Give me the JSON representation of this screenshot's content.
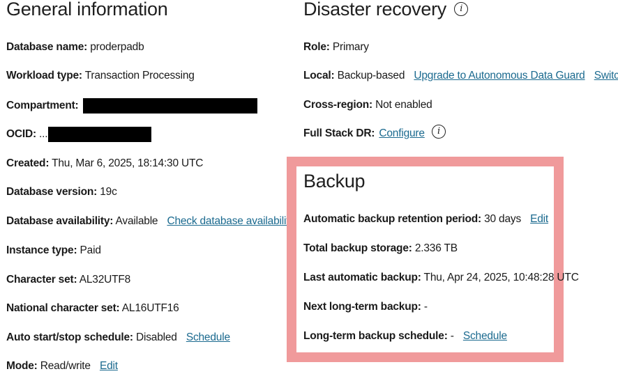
{
  "general": {
    "title": "General information",
    "database_name": {
      "label": "Database name:",
      "value": "proderpadb"
    },
    "workload_type": {
      "label": "Workload type:",
      "value": "Transaction Processing"
    },
    "compartment": {
      "label": "Compartment:"
    },
    "ocid": {
      "label": "OCID:",
      "value": "..."
    },
    "created": {
      "label": "Created:",
      "value": "Thu, Mar 6, 2025, 18:14:30 UTC"
    },
    "database_version": {
      "label": "Database version:",
      "value": "19c"
    },
    "database_availability": {
      "label": "Database availability:",
      "value": "Available",
      "link": "Check database availability"
    },
    "instance_type": {
      "label": "Instance type:",
      "value": "Paid"
    },
    "character_set": {
      "label": "Character set:",
      "value": "AL32UTF8"
    },
    "national_character_set": {
      "label": "National character set:",
      "value": "AL16UTF16"
    },
    "auto_start_stop": {
      "label": "Auto start/stop schedule:",
      "value": "Disabled",
      "link": "Schedule"
    },
    "mode": {
      "label": "Mode:",
      "value": "Read/write",
      "link": "Edit"
    }
  },
  "disaster_recovery": {
    "title": "Disaster recovery",
    "role": {
      "label": "Role:",
      "value": "Primary"
    },
    "local": {
      "label": "Local:",
      "value": "Backup-based",
      "link1": "Upgrade to Autonomous Data Guard",
      "link2": "Switchover"
    },
    "cross_region": {
      "label": "Cross-region:",
      "value": "Not enabled"
    },
    "full_stack_dr": {
      "label": "Full Stack DR:",
      "link": "Configure"
    }
  },
  "backup": {
    "title": "Backup",
    "retention": {
      "label": "Automatic backup retention period:",
      "value": "30 days",
      "link": "Edit"
    },
    "total_storage": {
      "label": "Total backup storage:",
      "value": "2.336 TB"
    },
    "last_automatic": {
      "label": "Last automatic backup:",
      "value": "Thu, Apr 24, 2025, 10:48:28 UTC"
    },
    "next_long_term": {
      "label": "Next long-term backup:",
      "value": "-"
    },
    "long_term_schedule": {
      "label": "Long-term backup schedule:",
      "value": "-",
      "link": "Schedule"
    }
  },
  "icons": {
    "info": "info-icon"
  },
  "colors": {
    "link": "#1b6a8f",
    "highlight_border": "#f09a9b"
  }
}
